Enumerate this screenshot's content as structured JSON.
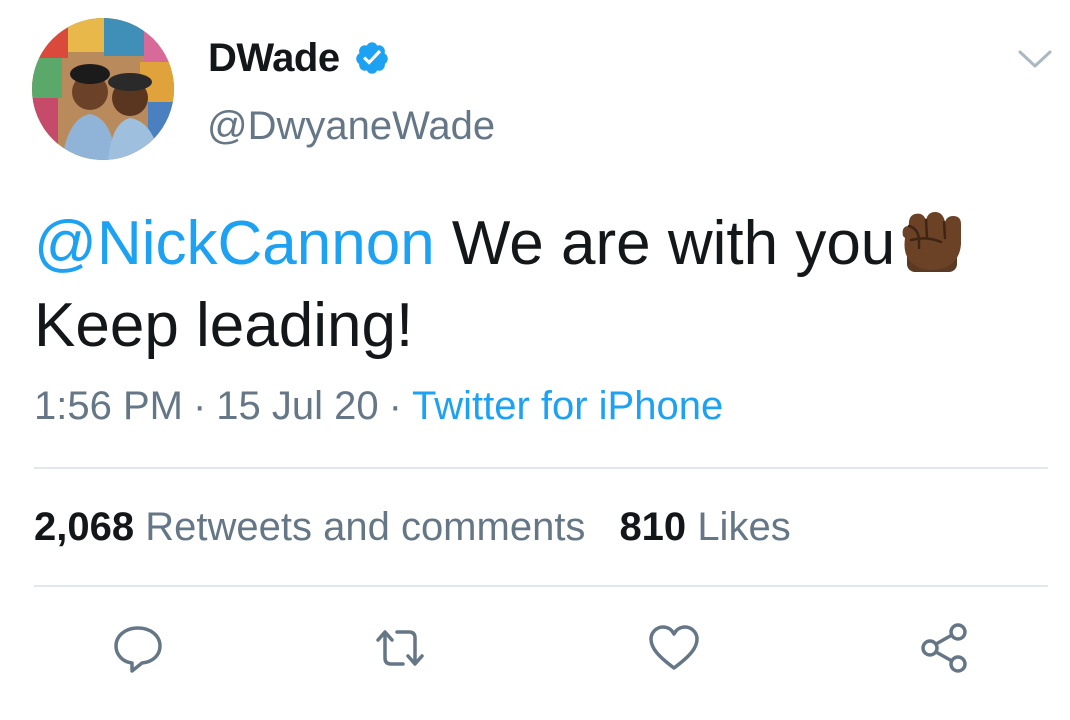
{
  "author": {
    "display_name": "DWade",
    "handle": "@DwyaneWade",
    "verified": true,
    "avatar_icon": "avatar-photo"
  },
  "tweet": {
    "mention": "@NickCannon",
    "text_line1": " We are with you",
    "emoji": "raised-fist-dark-skin-tone",
    "text_line2": "Keep leading!"
  },
  "meta": {
    "time": "1:56 PM",
    "separator": "·",
    "date": "15 Jul 20",
    "source": "Twitter for iPhone"
  },
  "stats": {
    "retweets_count": "2,068",
    "retweets_label": "Retweets and comments",
    "likes_count": "810",
    "likes_label": "Likes"
  },
  "actions": [
    {
      "name": "reply",
      "icon": "comment-icon"
    },
    {
      "name": "retweet",
      "icon": "retweet-icon"
    },
    {
      "name": "like",
      "icon": "heart-icon"
    },
    {
      "name": "share",
      "icon": "share-icon"
    }
  ],
  "colors": {
    "accent": "#1da1f2",
    "text": "#14171a",
    "muted": "#657786",
    "divider": "#e1e8ed"
  }
}
